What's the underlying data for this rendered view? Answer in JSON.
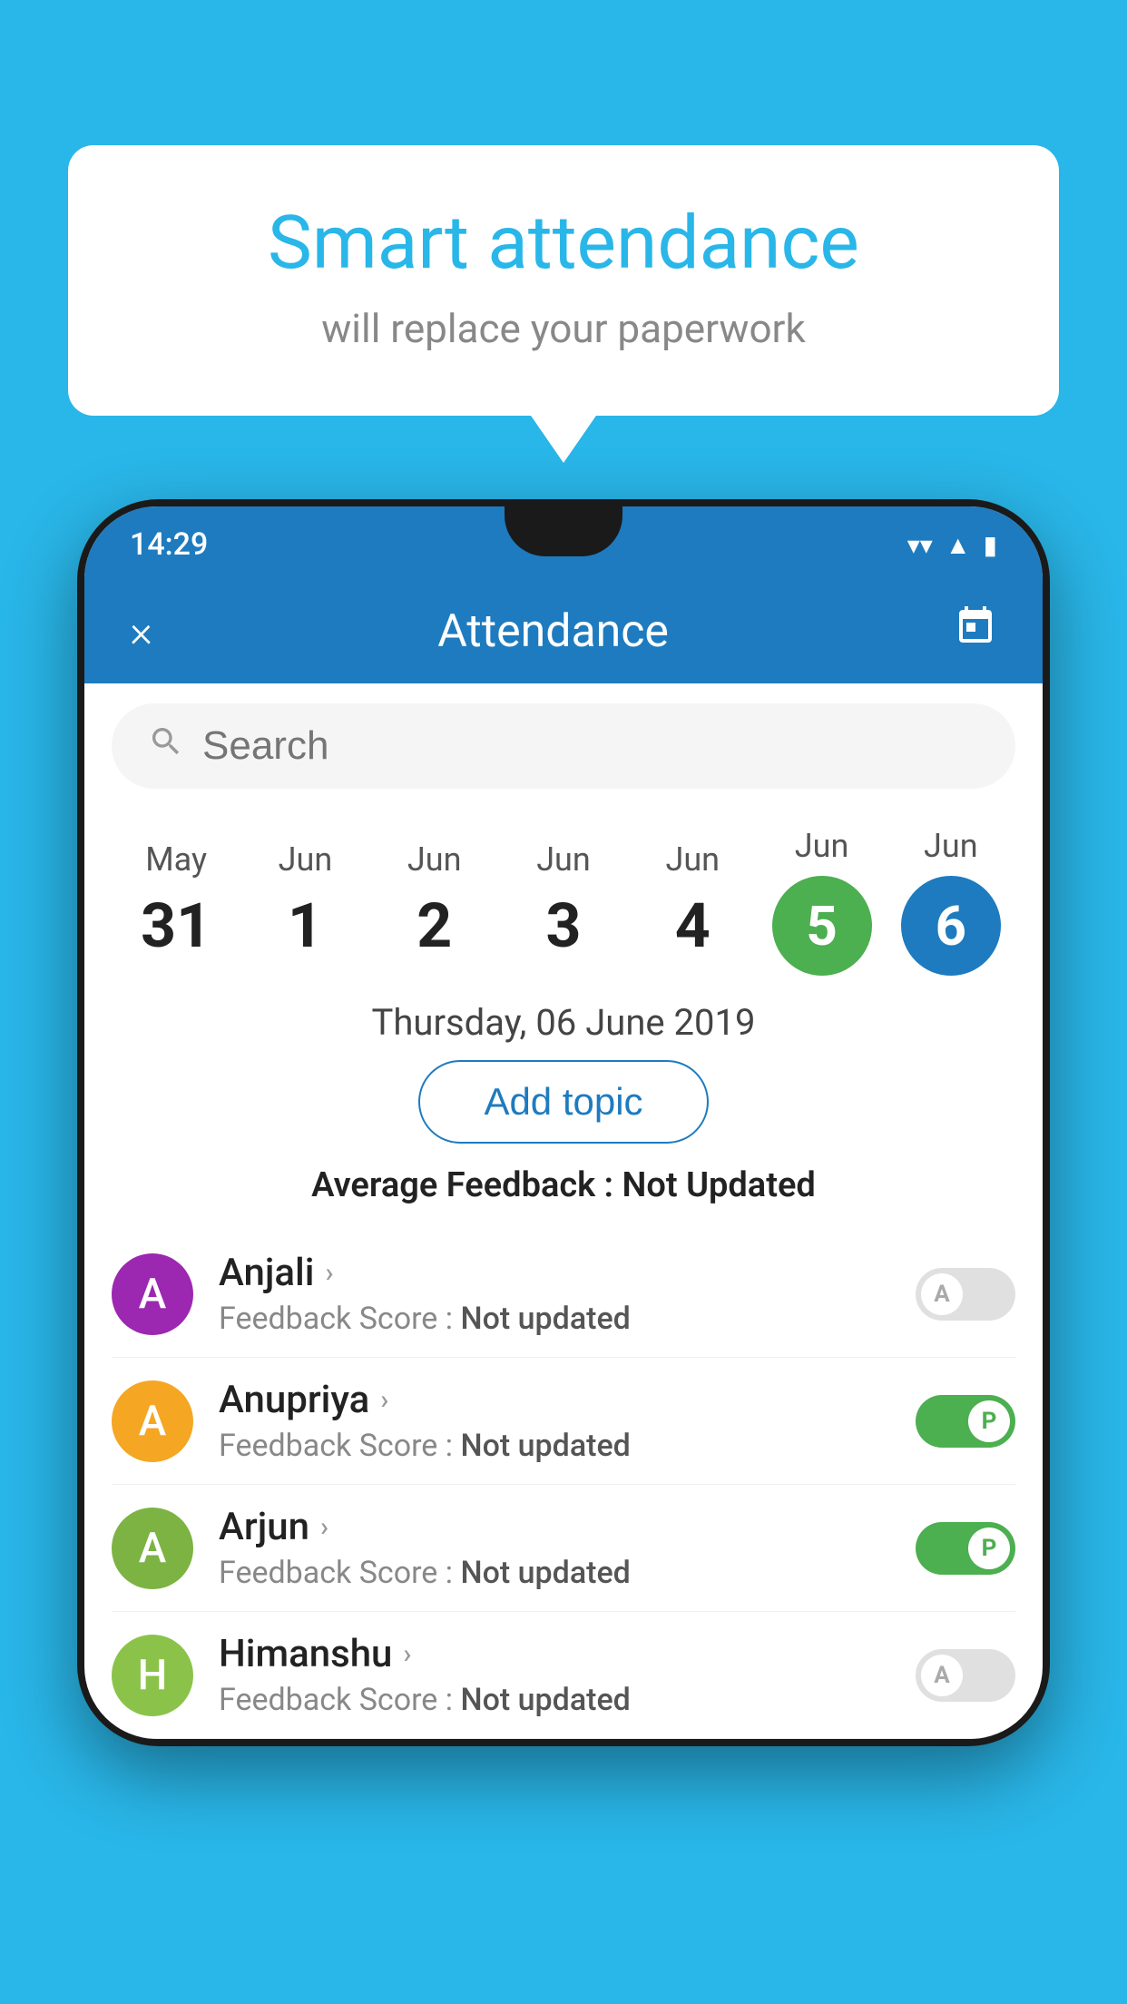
{
  "background_color": "#29b6e8",
  "speech_bubble": {
    "title": "Smart attendance",
    "subtitle": "will replace your paperwork"
  },
  "status_bar": {
    "time": "14:29",
    "icons": [
      "wifi",
      "signal",
      "battery"
    ]
  },
  "app_bar": {
    "title": "Attendance",
    "close_label": "×",
    "calendar_icon": "📅"
  },
  "search": {
    "placeholder": "Search"
  },
  "calendar": {
    "dates": [
      {
        "month": "May",
        "day": "31",
        "selected": ""
      },
      {
        "month": "Jun",
        "day": "1",
        "selected": ""
      },
      {
        "month": "Jun",
        "day": "2",
        "selected": ""
      },
      {
        "month": "Jun",
        "day": "3",
        "selected": ""
      },
      {
        "month": "Jun",
        "day": "4",
        "selected": ""
      },
      {
        "month": "Jun",
        "day": "5",
        "selected": "green"
      },
      {
        "month": "Jun",
        "day": "6",
        "selected": "blue"
      }
    ],
    "selected_date_label": "Thursday, 06 June 2019"
  },
  "add_topic_label": "Add topic",
  "avg_feedback_label": "Average Feedback :",
  "avg_feedback_value": "Not Updated",
  "students": [
    {
      "name": "Anjali",
      "initial": "A",
      "avatar_color": "#9c27b0",
      "feedback_label": "Feedback Score :",
      "feedback_value": "Not updated",
      "toggle": "off",
      "toggle_letter": "A"
    },
    {
      "name": "Anupriya",
      "initial": "A",
      "avatar_color": "#f5a623",
      "feedback_label": "Feedback Score :",
      "feedback_value": "Not updated",
      "toggle": "on",
      "toggle_letter": "P"
    },
    {
      "name": "Arjun",
      "initial": "A",
      "avatar_color": "#7cb342",
      "feedback_label": "Feedback Score :",
      "feedback_value": "Not updated",
      "toggle": "on",
      "toggle_letter": "P"
    },
    {
      "name": "Himanshu",
      "initial": "H",
      "avatar_color": "#8bc34a",
      "feedback_label": "Feedback Score :",
      "feedback_value": "Not updated",
      "toggle": "off",
      "toggle_letter": "A"
    }
  ]
}
